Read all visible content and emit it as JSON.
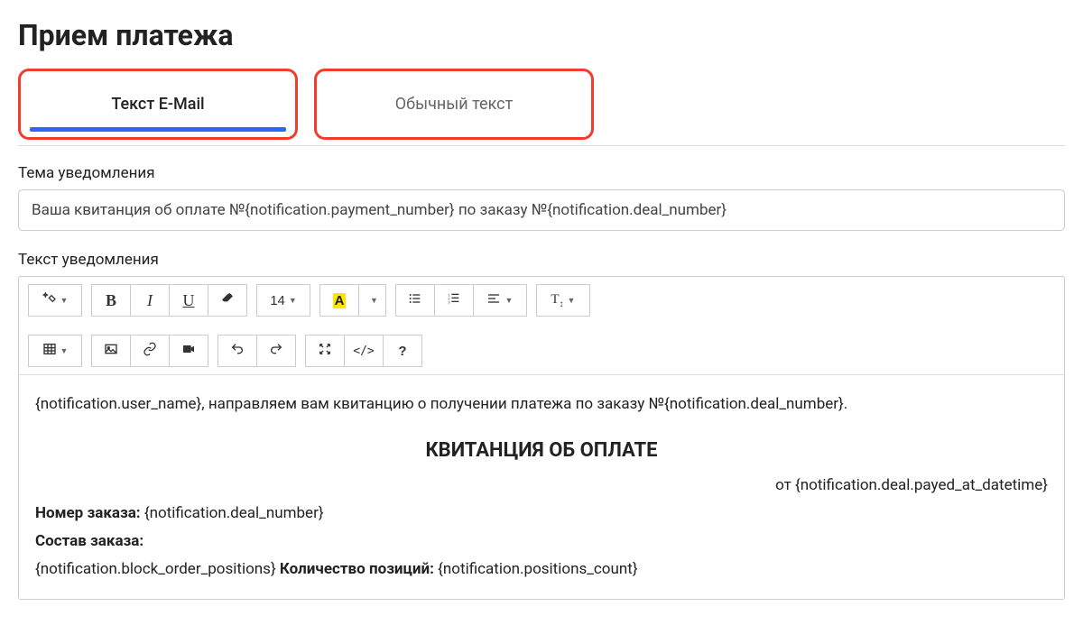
{
  "page": {
    "title": "Прием платежа"
  },
  "tabs": {
    "email": "Текст E-Mail",
    "plain": "Обычный текст"
  },
  "labels": {
    "subject": "Тема уведомления",
    "body": "Текст уведомления"
  },
  "subject_value": "Ваша квитанция об оплате №{notification.payment_number} по заказу №{notification.deal_number}",
  "toolbar": {
    "bold": "B",
    "italic": "I",
    "underline": "U",
    "fontsize": "14",
    "fontcolor": "A",
    "clearfmt": "T",
    "help": "?",
    "codeview": "</>"
  },
  "body": {
    "line1_a": "{notification.user_name}, направляем вам квитанцию о получении платежа по заказу №{notification.deal_number}.",
    "title": "КВИТАНЦИЯ ОБ ОПЛАТЕ",
    "date_line": "от {notification.deal.payed_at_datetime}",
    "order_label": "Номер заказа:",
    "order_value": " {notification.deal_number}",
    "items_label": "Состав заказа:",
    "positions_block": "{notification.block_order_positions} ",
    "count_label": "Количество позиций:",
    "count_value": " {notification.positions_count}"
  }
}
